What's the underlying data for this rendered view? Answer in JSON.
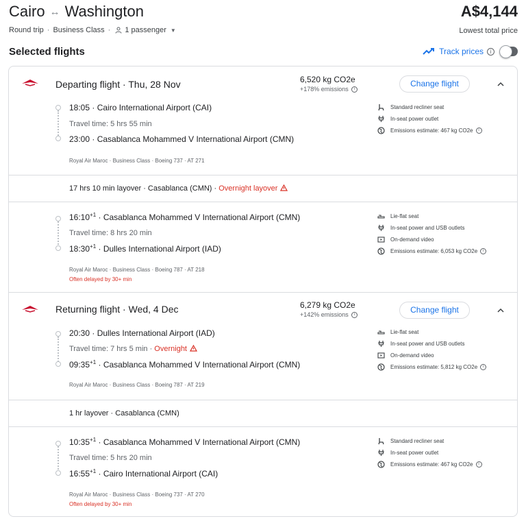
{
  "header": {
    "origin": "Cairo",
    "destination": "Washington",
    "price": "A$4,144",
    "price_sub": "Lowest total price",
    "trip_type": "Round trip",
    "cabin": "Business Class",
    "passengers": "1 passenger"
  },
  "selected": {
    "title": "Selected flights",
    "track_label": "Track prices"
  },
  "departing": {
    "title": "Departing flight · Thu, 28 Nov",
    "co2": "6,520 kg CO2e",
    "co2_sub": "+178% emissions",
    "change_label": "Change flight",
    "leg1": {
      "dep_time": "18:05",
      "dep_sup": "",
      "dep_airport": "Cairo International Airport (CAI)",
      "travel": "Travel time: 5 hrs 55 min",
      "arr_time": "23:00",
      "arr_sup": "",
      "arr_airport": "Casablanca Mohammed V International Airport (CMN)",
      "details": "Royal Air Maroc · Business Class · Boeing 737 · AT 271",
      "amenities": [
        "Standard recliner seat",
        "In-seat power outlet",
        "Emissions estimate: 467 kg CO2e"
      ]
    },
    "layover": "17 hrs 10 min layover · Casablanca (CMN) · ",
    "layover_warn": "Overnight layover",
    "leg2": {
      "dep_time": "16:10",
      "dep_sup": "+1",
      "dep_airport": "Casablanca Mohammed V International Airport (CMN)",
      "travel": "Travel time: 8 hrs 20 min",
      "arr_time": "18:30",
      "arr_sup": "+1",
      "arr_airport": "Dulles International Airport (IAD)",
      "details": "Royal Air Maroc · Business Class · Boeing 787 · AT 218",
      "delay": "Often delayed by 30+ min",
      "amenities": [
        "Lie-flat seat",
        "In-seat power and USB outlets",
        "On-demand video",
        "Emissions estimate: 6,053 kg CO2e"
      ]
    }
  },
  "returning": {
    "title": "Returning flight · Wed, 4 Dec",
    "co2": "6,279 kg CO2e",
    "co2_sub": "+142% emissions",
    "change_label": "Change flight",
    "leg1": {
      "dep_time": "20:30",
      "dep_sup": "",
      "dep_airport": "Dulles International Airport (IAD)",
      "travel": "Travel time: 7 hrs 5 min · ",
      "travel_warn": "Overnight",
      "arr_time": "09:35",
      "arr_sup": "+1",
      "arr_airport": "Casablanca Mohammed V International Airport (CMN)",
      "details": "Royal Air Maroc · Business Class · Boeing 787 · AT 219",
      "amenities": [
        "Lie-flat seat",
        "In-seat power and USB outlets",
        "On-demand video",
        "Emissions estimate: 5,812 kg CO2e"
      ]
    },
    "layover": "1 hr layover · Casablanca (CMN)",
    "leg2": {
      "dep_time": "10:35",
      "dep_sup": "+1",
      "dep_airport": "Casablanca Mohammed V International Airport (CMN)",
      "travel": "Travel time: 5 hrs 20 min",
      "arr_time": "16:55",
      "arr_sup": "+1",
      "arr_airport": "Cairo International Airport (CAI)",
      "details": "Royal Air Maroc · Business Class · Boeing 737 · AT 270",
      "delay": "Often delayed by 30+ min",
      "amenities": [
        "Standard recliner seat",
        "In-seat power outlet",
        "Emissions estimate: 467 kg CO2e"
      ]
    }
  },
  "colors": {
    "accent": "#1a73e8",
    "warning": "#d93025",
    "airline": "#c8102e"
  }
}
